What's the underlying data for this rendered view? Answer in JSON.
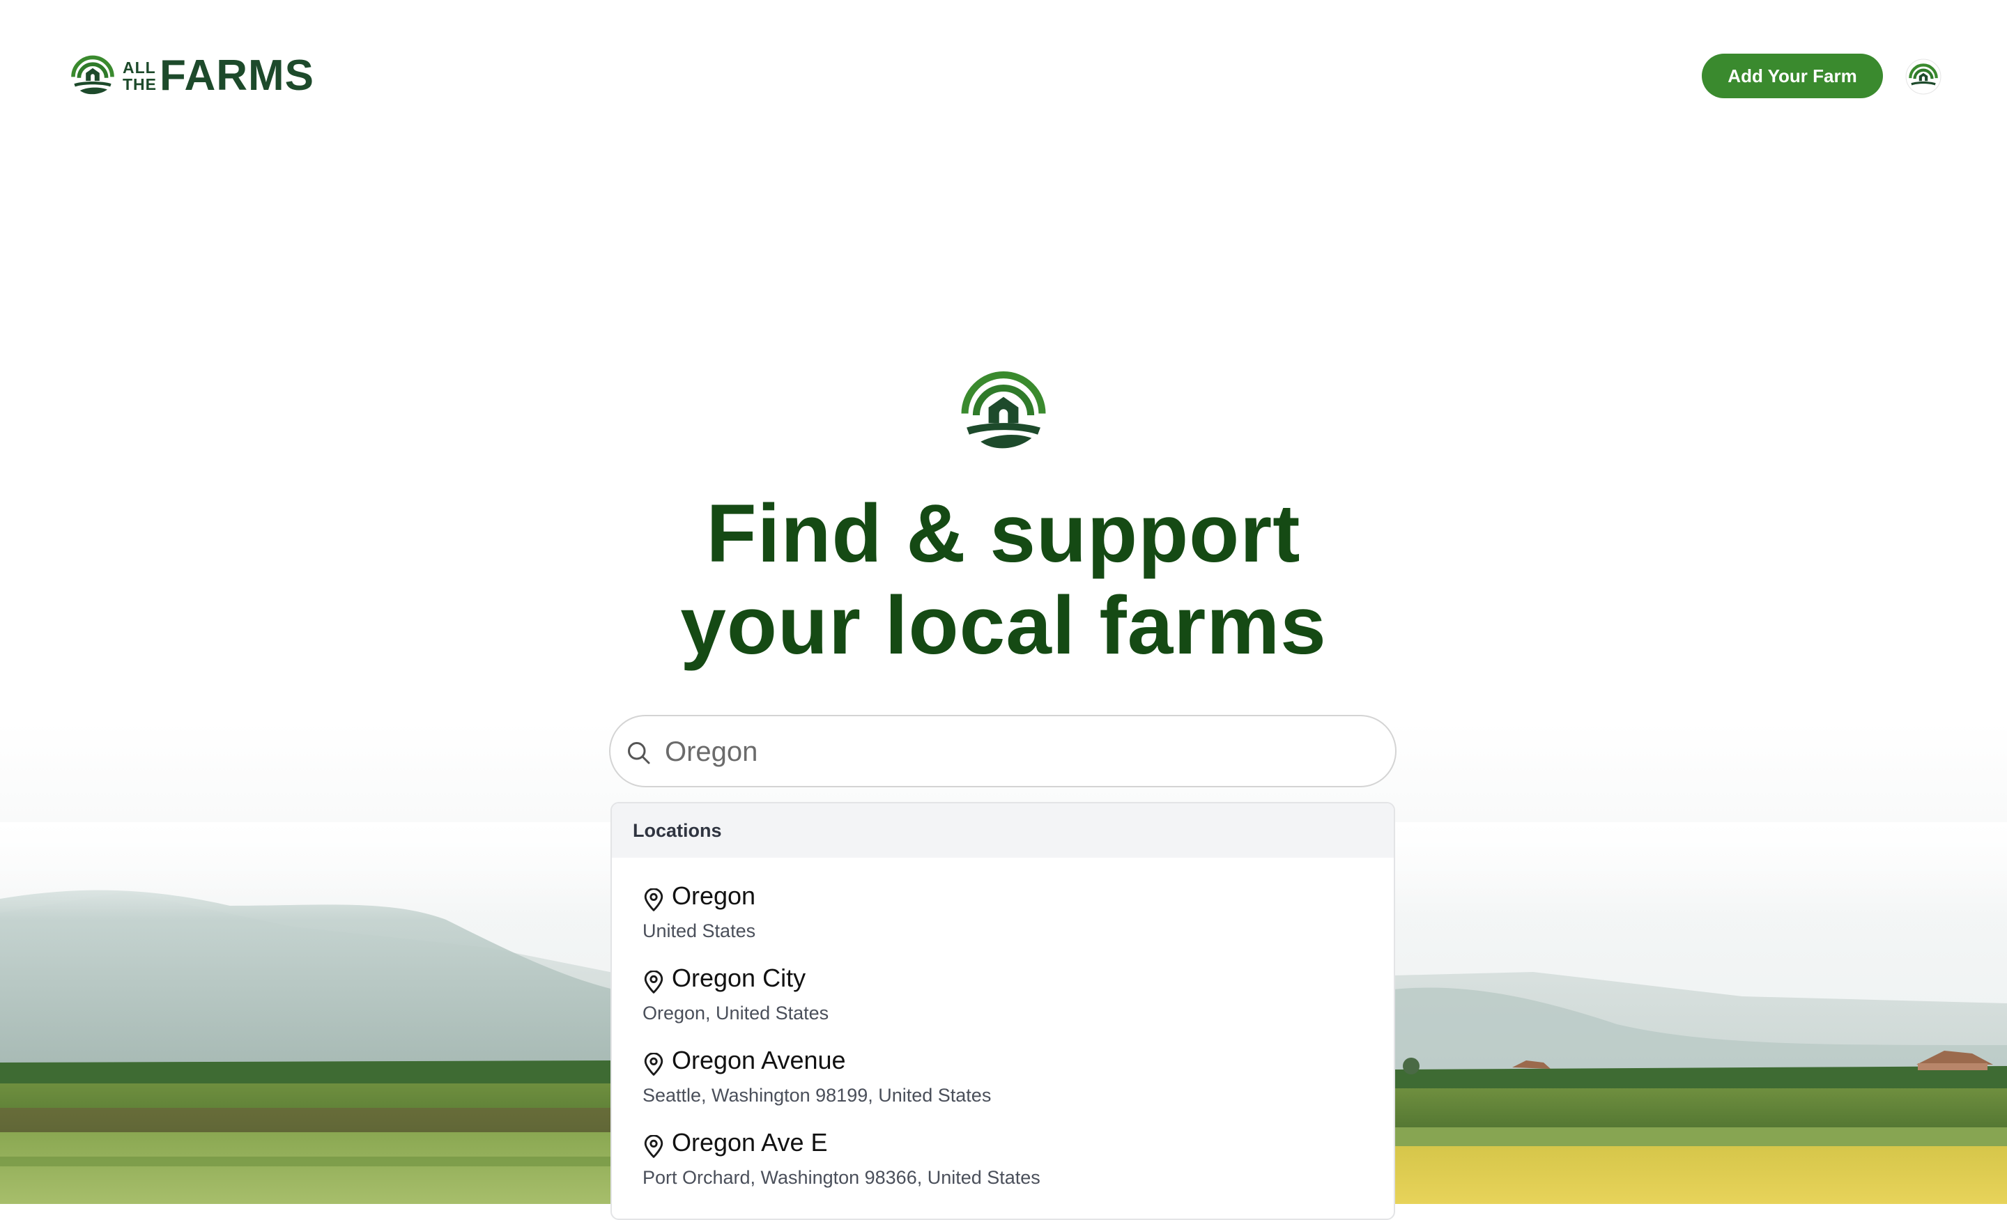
{
  "header": {
    "logo_small_line1": "ALL",
    "logo_small_line2": "THE",
    "logo_big": "FARMS",
    "add_farm_label": "Add Your Farm"
  },
  "hero": {
    "headline_line1": "Find & support",
    "headline_line2": "your local farms"
  },
  "search": {
    "value": "Oregon"
  },
  "dropdown": {
    "section_label": "Locations",
    "results": [
      {
        "title": "Oregon",
        "subtitle": "United States"
      },
      {
        "title": "Oregon City",
        "subtitle": "Oregon, United States"
      },
      {
        "title": "Oregon Avenue",
        "subtitle": "Seattle, Washington 98199, United States"
      },
      {
        "title": "Oregon Ave E",
        "subtitle": "Port Orchard, Washington 98366, United States"
      }
    ]
  },
  "colors": {
    "brand_green": "#3a8a2e",
    "headline_green": "#154a14",
    "logo_dark": "#1d4a2b"
  },
  "icons": [
    "farm-logo-icon",
    "search-icon",
    "map-pin-icon"
  ]
}
